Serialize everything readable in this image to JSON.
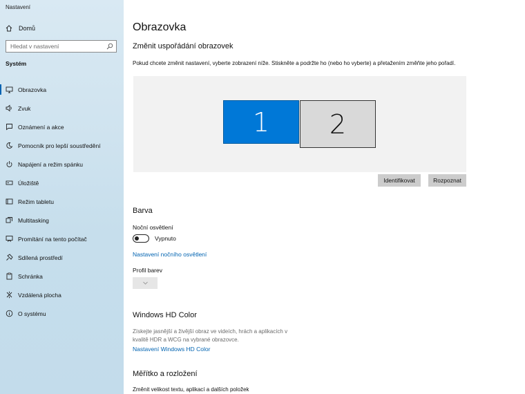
{
  "window": {
    "title": "Nastavení"
  },
  "sidebar": {
    "home_label": "Domů",
    "search_placeholder": "Hledat v nastavení",
    "section_label": "Systém",
    "items": [
      {
        "label": "Obrazovka",
        "icon": "monitor-icon"
      },
      {
        "label": "Zvuk",
        "icon": "speaker-icon"
      },
      {
        "label": "Oznámení a akce",
        "icon": "notification-icon"
      },
      {
        "label": "Pomocník pro lepší soustředění",
        "icon": "moon-icon"
      },
      {
        "label": "Napájení a režim spánku",
        "icon": "power-icon"
      },
      {
        "label": "Úložiště",
        "icon": "storage-icon"
      },
      {
        "label": "Režim tabletu",
        "icon": "tablet-icon"
      },
      {
        "label": "Multitasking",
        "icon": "multitasking-icon"
      },
      {
        "label": "Promítání na tento počítač",
        "icon": "project-icon"
      },
      {
        "label": "Sdílená prostředí",
        "icon": "shared-icon"
      },
      {
        "label": "Schránka",
        "icon": "clipboard-icon"
      },
      {
        "label": "Vzdálená plocha",
        "icon": "remote-desktop-icon"
      },
      {
        "label": "O systému",
        "icon": "info-icon"
      }
    ],
    "active_index": 0
  },
  "main": {
    "title": "Obrazovka",
    "arrangement": {
      "heading": "Změnit uspořádání obrazovek",
      "description": "Pokud chcete změnit nastavení, vyberte zobrazení níže. Stiskněte a podržte ho (nebo ho vyberte) a přetažením změňte jeho pořadí.",
      "monitor1_label": "1",
      "monitor2_label": "2",
      "identify_button": "Identifikovat",
      "detect_button": "Rozpoznat"
    },
    "color": {
      "heading": "Barva",
      "night_light_label": "Noční osvětlení",
      "night_light_state": "Vypnuto",
      "night_light_settings_link": "Nastavení nočního osvětlení",
      "color_profile_label": "Profil barev"
    },
    "hdr": {
      "heading": "Windows HD Color",
      "description_line1": "Získejte jasnější a živější obraz ve videích, hrách a aplikacích v",
      "description_line2": "kvalitě HDR a WCG na vybrané obrazovce.",
      "settings_link": "Nastavení Windows HD Color"
    },
    "scale": {
      "heading": "Měřítko a rozložení",
      "change_size_label": "Změnit velikost textu, aplikací a dalších položek"
    }
  },
  "colors": {
    "accent": "#0078d7",
    "link": "#0063b1"
  }
}
